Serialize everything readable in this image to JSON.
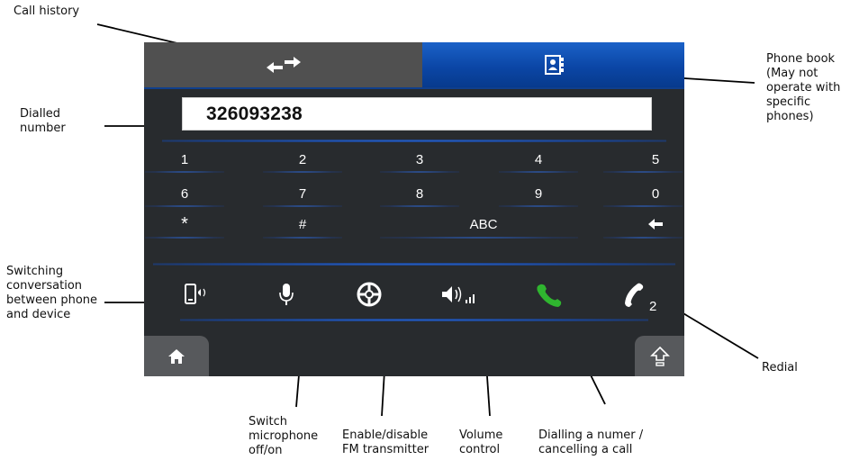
{
  "annotations": {
    "call_history": "Call history",
    "phone_book": "Phone book (May not operate with specific phones)",
    "dialled_number": "Dialled number",
    "switching_conversation": "Switching conversation between phone and device",
    "redial": "Redial",
    "switch_microphone": "Switch microphone off/on",
    "fm_transmitter": "Enable/disable FM transmitter",
    "volume_control": "Volume control",
    "dialling": "Dialling a numer / cancelling a call"
  },
  "tabs": {
    "history_icon": "swap-arrows-icon",
    "phonebook_icon": "contact-book-icon"
  },
  "dial": {
    "value": "326093238"
  },
  "keypad": {
    "row1": [
      "1",
      "2",
      "3",
      "4",
      "5"
    ],
    "row2": [
      "6",
      "7",
      "8",
      "9",
      "0"
    ],
    "row3": [
      "*",
      "#",
      "ABC",
      "backspace-arrow-icon"
    ]
  },
  "controls": {
    "redial_sub": "2",
    "icons": [
      "phone-device-switch-icon",
      "microphone-icon",
      "fm-transmitter-icon",
      "volume-icon",
      "green-call-icon",
      "redial-icon"
    ]
  },
  "bottom": {
    "home_icon": "home-icon",
    "shift_icon": "shift-up-icon"
  },
  "colors": {
    "screen_bg": "#282b2e",
    "tab_active": "#0b46a6",
    "call_green": "#2fb52f"
  }
}
